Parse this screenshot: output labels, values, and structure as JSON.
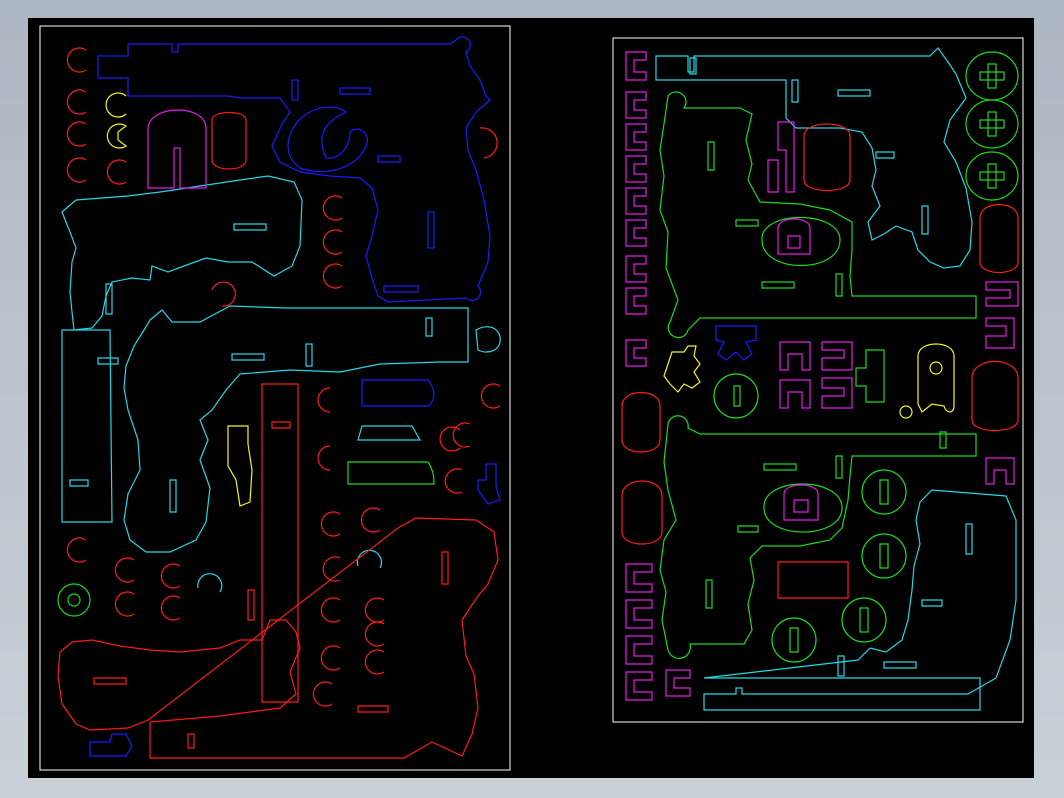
{
  "drawing": {
    "background": "#000000",
    "frame_color": "#ffffff",
    "sheets": [
      "left-sheet",
      "right-sheet"
    ],
    "layer_colors": {
      "red": "#ff1a1a",
      "blue": "#1a1aff",
      "cyan": "#22d8e8",
      "yellow": "#f5f51a",
      "magenta": "#e61ae6",
      "green": "#1adb1a"
    }
  }
}
